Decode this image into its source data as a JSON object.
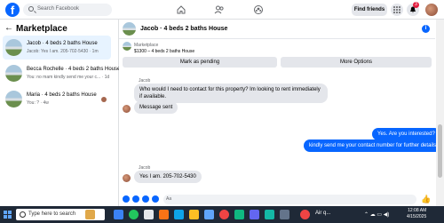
{
  "topbar": {
    "logo": "f",
    "search_placeholder": "Search Facebook",
    "find_friends": "Find friends",
    "notification_count": "3",
    "nav_icons": [
      "home-icon",
      "friends-icon",
      "groups-icon"
    ]
  },
  "sidebar": {
    "title": "Marketplace",
    "conversations": [
      {
        "name": "Jacob · 4 beds 2 baths House",
        "preview": "Jacob: Yes I am. 205-702-5430 · 1m"
      },
      {
        "name": "Becca Rochelle · 4 beds 2 baths House",
        "preview": "You: no mam kindly send me your c... · 1d"
      },
      {
        "name": "Maria · 4 beds 2 baths House",
        "preview": "You: ? · 4w"
      }
    ]
  },
  "chat": {
    "title": "Jacob · 4 beds 2 baths House",
    "listing_category": "Marketplace",
    "listing_subtitle": "$1300 – 4 beds 2 baths House",
    "mark_pending": "Mark as pending",
    "more_options": "More Options",
    "messages": {
      "in_sender_1": "Jacob",
      "in_1": "Who would I need to contact for this property? Im looking to rent immediately if available.",
      "in_2": "Message sent",
      "out_1": "Yes. Are you interested?",
      "out_2": "kindly send me your contact number for further details",
      "in_sender_2": "Jacob",
      "in_3": "Yes I am. 205-702-5430"
    },
    "composer_placeholder": "Aa"
  },
  "taskbar": {
    "search_placeholder": "Type here to search",
    "weather": "Air q...",
    "time": "12:08 AM",
    "date": "4/15/2025"
  },
  "colors": {
    "accent": "#0866ff",
    "bubble_in": "#e4e6eb",
    "badge": "#e41e3f"
  }
}
